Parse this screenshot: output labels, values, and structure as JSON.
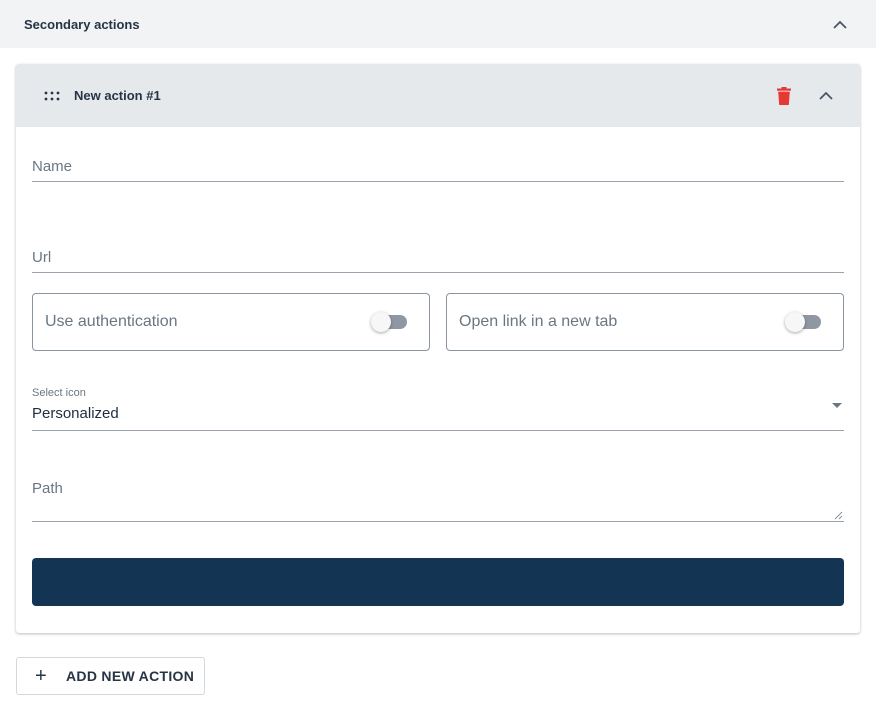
{
  "section": {
    "title": "Secondary actions",
    "collapse_icon": "chevron-up-icon"
  },
  "action_card": {
    "title": "New action #1",
    "drag_icon": "drag-handle-icon",
    "delete_icon": "trash-icon",
    "delete_color": "#e53935",
    "collapse_icon": "chevron-up-icon",
    "fields": {
      "name": {
        "label": "Name",
        "value": ""
      },
      "url": {
        "label": "Url",
        "value": ""
      },
      "use_authentication": {
        "label": "Use authentication",
        "checked": false
      },
      "open_new_tab": {
        "label": "Open link in a new tab",
        "checked": false
      },
      "select_icon": {
        "label": "Select icon",
        "value": "Personalized"
      },
      "path": {
        "label": "Path",
        "value": ""
      }
    },
    "save_button_color": "#133453"
  },
  "add_button": {
    "label": "ADD NEW ACTION",
    "icon": "plus-icon"
  }
}
